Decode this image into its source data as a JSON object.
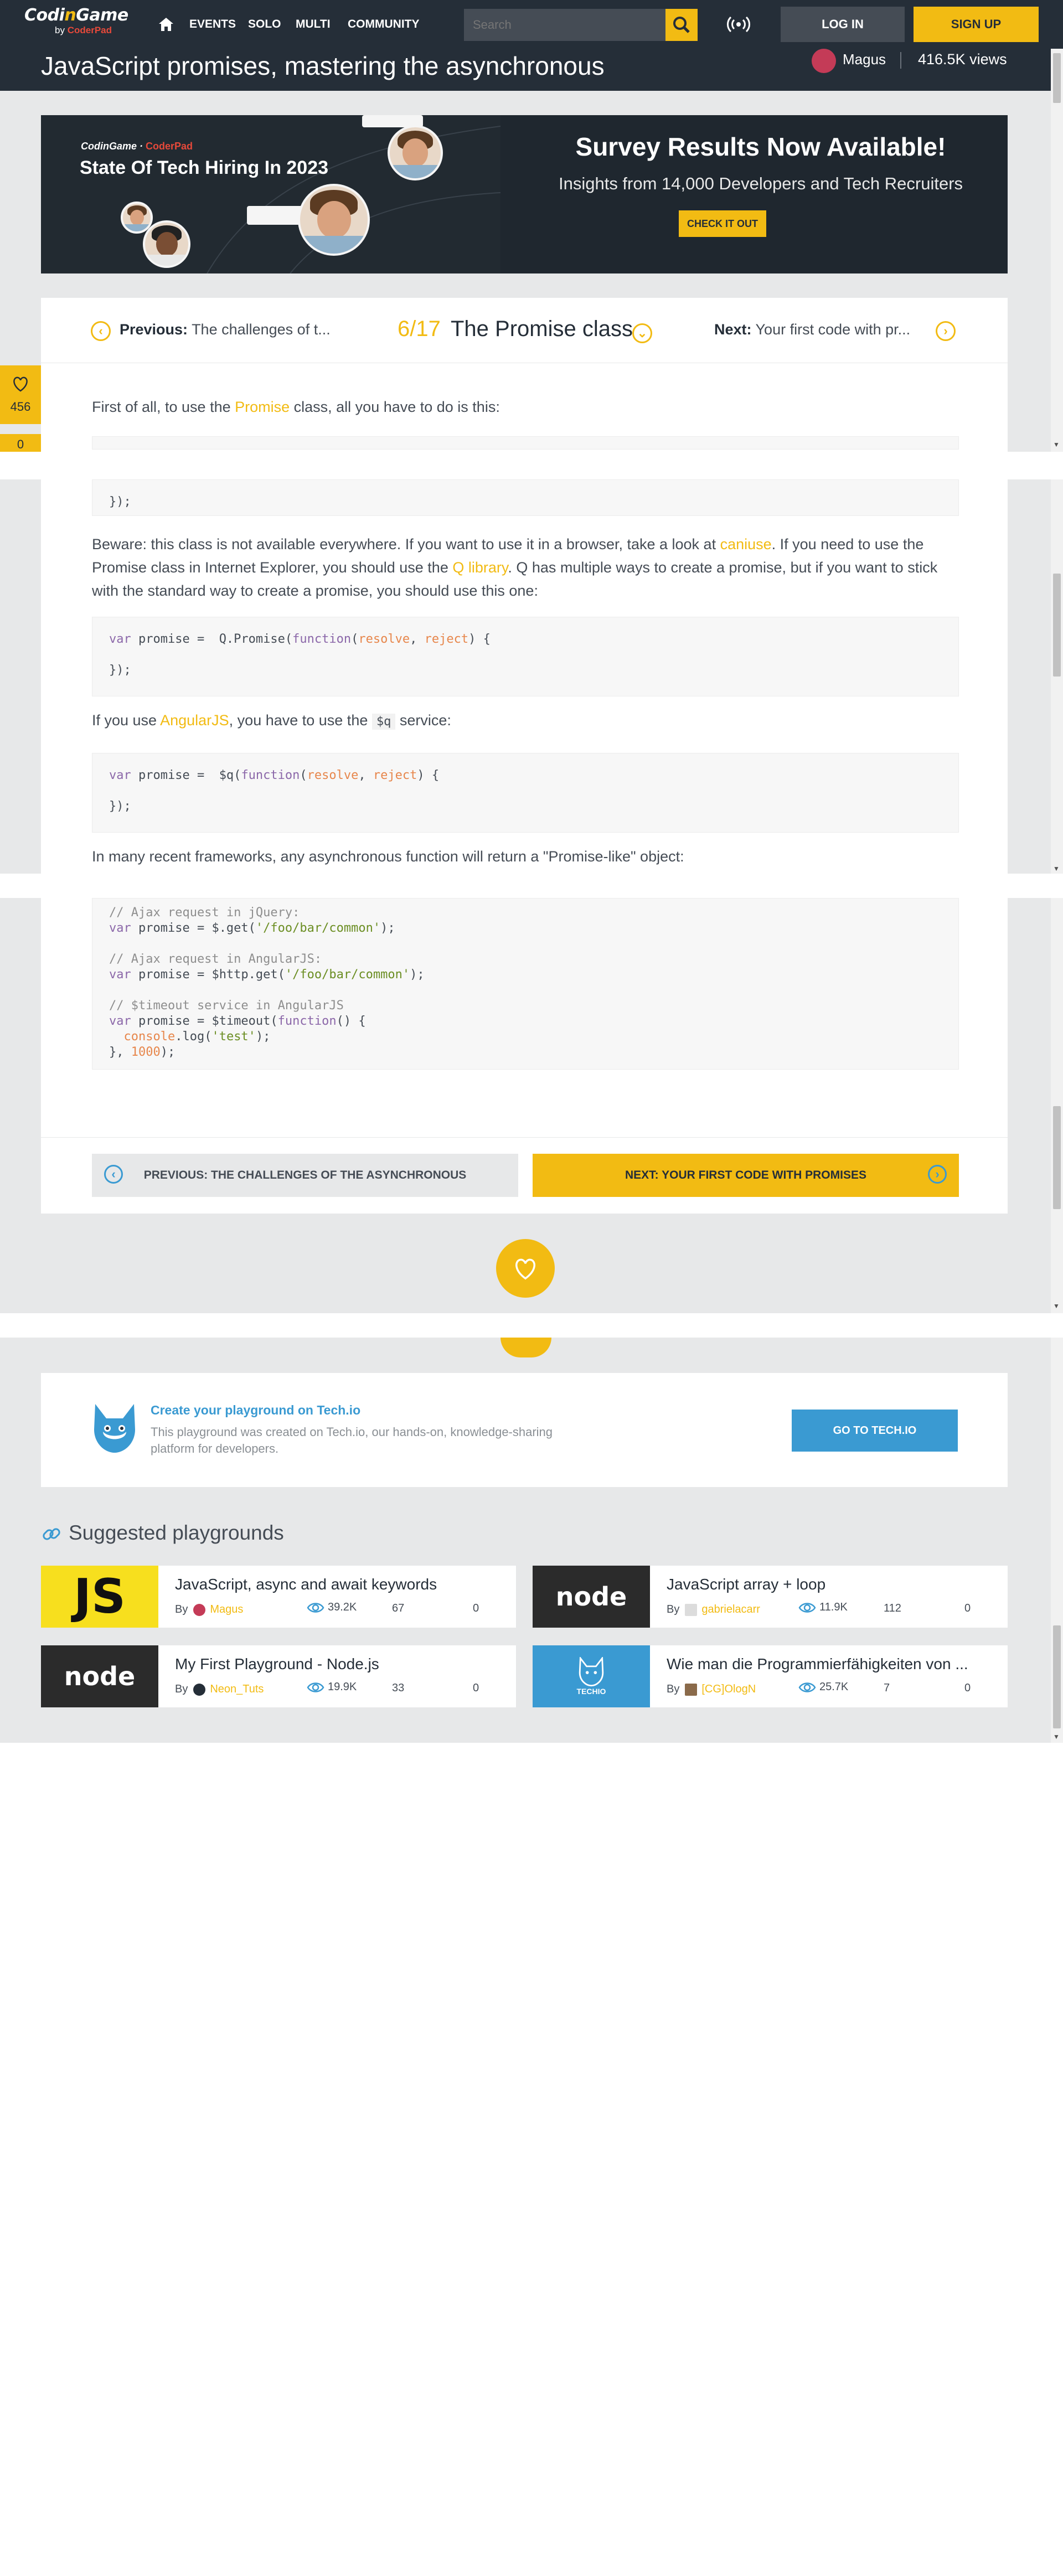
{
  "nav": {
    "logo_main_a": "Codi",
    "logo_main_b": "n",
    "logo_main_c": "Game",
    "logo_by": "by",
    "logo_coderpad": "CoderPad",
    "links": [
      "EVENTS",
      "SOLO",
      "MULTI",
      "COMMUNITY"
    ],
    "search_placeholder": "Search",
    "login": "LOG IN",
    "signup": "SIGN UP"
  },
  "titlebar": {
    "title": "JavaScript promises, mastering the asynchronous",
    "author": "Magus",
    "views": "416.5K views"
  },
  "banner": {
    "brand_cg": "CodinGame",
    "brand_cp": "CoderPad",
    "headline": "State Of Tech Hiring In 2023",
    "title": "Survey Results Now Available!",
    "subtitle": "Insights from 14,000 Developers and Tech Recruiters",
    "cta": "CHECK IT OUT"
  },
  "lesson_nav": {
    "prev_label": "Previous:",
    "prev_title": "The challenges of t...",
    "step": "6/17",
    "current_title": "The Promise class",
    "next_label": "Next:",
    "next_title": "Your first code with pr..."
  },
  "content": {
    "p1_a": "First of all, to use the ",
    "p1_link": "Promise",
    "p1_b": " class, all you have to do is this:",
    "code1_tail": "});",
    "p2_a": "Beware: this class is not available everywhere. If you want to use it in a browser, take a look at ",
    "p2_link1": "caniuse",
    "p2_b": ". If you need to use the Promise class in Internet Explorer, you should use the ",
    "p2_link2": "Q library",
    "p2_c": ". Q has multiple ways to create a promise, but if you want to stick with the standard way to create a promise, you should use this one:",
    "p3_a": "If you use ",
    "p3_link": "AngularJS",
    "p3_b": ", you have to use the ",
    "p3_code": "$q",
    "p3_c": " service:",
    "p4": "In many recent frameworks, any asynchronous function will return a \"Promise-like\" object:"
  },
  "lesson_footer": {
    "prev_button": "PREVIOUS: THE CHALLENGES OF THE ASYNCHRONOUS",
    "next_button": "NEXT: YOUR FIRST CODE WITH PROMISES"
  },
  "side": {
    "like_count": "456",
    "like_count2": "0"
  },
  "techio": {
    "title": "Create your playground on Tech.io",
    "desc": "This playground was created on Tech.io, our hands-on, knowledge-sharing platform for developers.",
    "button": "GO TO TECH.IO"
  },
  "suggested": {
    "heading": "Suggested playgrounds",
    "by": "By",
    "items": [
      {
        "title": "JavaScript, async and await keywords",
        "author": "Magus",
        "views": "39.2K",
        "likes": "67",
        "comments": "0",
        "thumb": "JS"
      },
      {
        "title": "JavaScript array + loop",
        "author": "gabrielacarr",
        "views": "11.9K",
        "likes": "112",
        "comments": "0",
        "thumb": "node"
      },
      {
        "title": "My First Playground - Node.js",
        "author": "Neon_Tuts",
        "views": "19.9K",
        "likes": "33",
        "comments": "0",
        "thumb": "node"
      },
      {
        "title": "Wie man die Programmierfähigkeiten von ...",
        "author": "[CG]OlogN",
        "views": "25.7K",
        "likes": "7",
        "comments": "0",
        "thumb": "TECHIO"
      }
    ]
  },
  "colors": {
    "accent": "#f2bb13",
    "nav_bg": "#252e38",
    "techio_blue": "#3a9ad2"
  }
}
